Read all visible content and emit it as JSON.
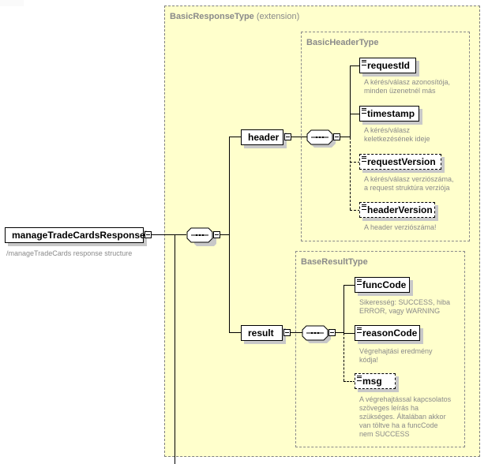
{
  "root": {
    "name": "manageTradeCardsResponse",
    "description": "/manageTradeCards response structure"
  },
  "groups": {
    "outer": {
      "title": "BasicResponseType",
      "suffix": "(extension)"
    },
    "header_type": {
      "title": "BasicHeaderType"
    },
    "result_type": {
      "title": "BaseResultType"
    }
  },
  "header": {
    "name": "header",
    "children": [
      {
        "name": "requestId",
        "optional": false,
        "description": [
          "A kérés/válasz azonosítója,",
          "minden üzenetnél más"
        ]
      },
      {
        "name": "timestamp",
        "optional": false,
        "description": [
          "A kérés/válasz",
          "keletkezésének ideje"
        ]
      },
      {
        "name": "requestVersion",
        "optional": true,
        "description": [
          "A kérés/válasz verziószáma,",
          "a request struktúra verziója"
        ]
      },
      {
        "name": "headerVersion",
        "optional": true,
        "description": [
          "A header verziószáma!"
        ]
      }
    ]
  },
  "result": {
    "name": "result",
    "children": [
      {
        "name": "funcCode",
        "optional": false,
        "description": [
          "Sikeresség: SUCCESS, hiba",
          "ERROR, vagy WARNING"
        ]
      },
      {
        "name": "reasonCode",
        "optional": false,
        "description": [
          "Végrehajtási eredmény",
          "kódja!"
        ]
      },
      {
        "name": "msg",
        "optional": true,
        "description": [
          "A végrehajtással kapcsolatos",
          "szöveges leírás ha",
          "szükséges. Általában akkor",
          "van töltve ha a funcCode",
          "nem SUCCESS"
        ]
      }
    ]
  },
  "icons": {
    "sequence": "sequence-compositor-icon",
    "collapse": "minus-box-icon",
    "documentation": "documentation-lines-icon"
  }
}
